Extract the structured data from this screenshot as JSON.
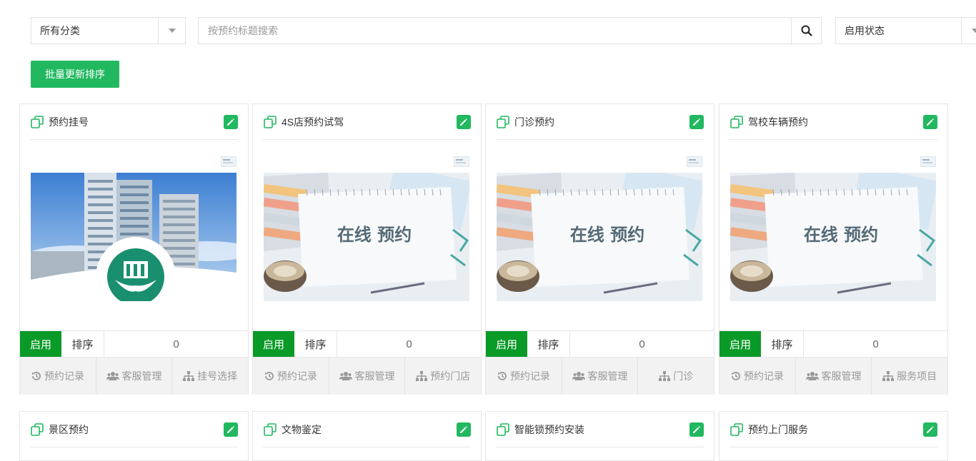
{
  "filters": {
    "category": "所有分类",
    "search_placeholder": "按预约标题搜索",
    "status": "启用状态"
  },
  "toolbar": {
    "batch_sort_label": "批量更新排序"
  },
  "colors": {
    "green": "#21b85f",
    "status_green": "#0a9a28"
  },
  "cards": [
    {
      "title": "预约挂号",
      "status": "启用",
      "sort_label": "排序",
      "sort_value": "0",
      "actions": [
        "预约记录",
        "客服管理",
        "挂号选择"
      ]
    },
    {
      "title": "4S店预约试驾",
      "status": "启用",
      "sort_label": "排序",
      "sort_value": "0",
      "actions": [
        "预约记录",
        "客服管理",
        "预约门店"
      ],
      "banner_text": "在线 预约"
    },
    {
      "title": "门诊预约",
      "status": "启用",
      "sort_label": "排序",
      "sort_value": "0",
      "actions": [
        "预约记录",
        "客服管理",
        "门诊"
      ],
      "banner_text": "在线 预约"
    },
    {
      "title": "驾校车辆预约",
      "status": "启用",
      "sort_label": "排序",
      "sort_value": "0",
      "actions": [
        "预约记录",
        "客服管理",
        "服务项目"
      ],
      "banner_text": "在线 预约"
    }
  ],
  "cards_row2": [
    {
      "title": "景区预约"
    },
    {
      "title": "文物鉴定"
    },
    {
      "title": "智能锁预约安装"
    },
    {
      "title": "预约上门服务"
    }
  ]
}
